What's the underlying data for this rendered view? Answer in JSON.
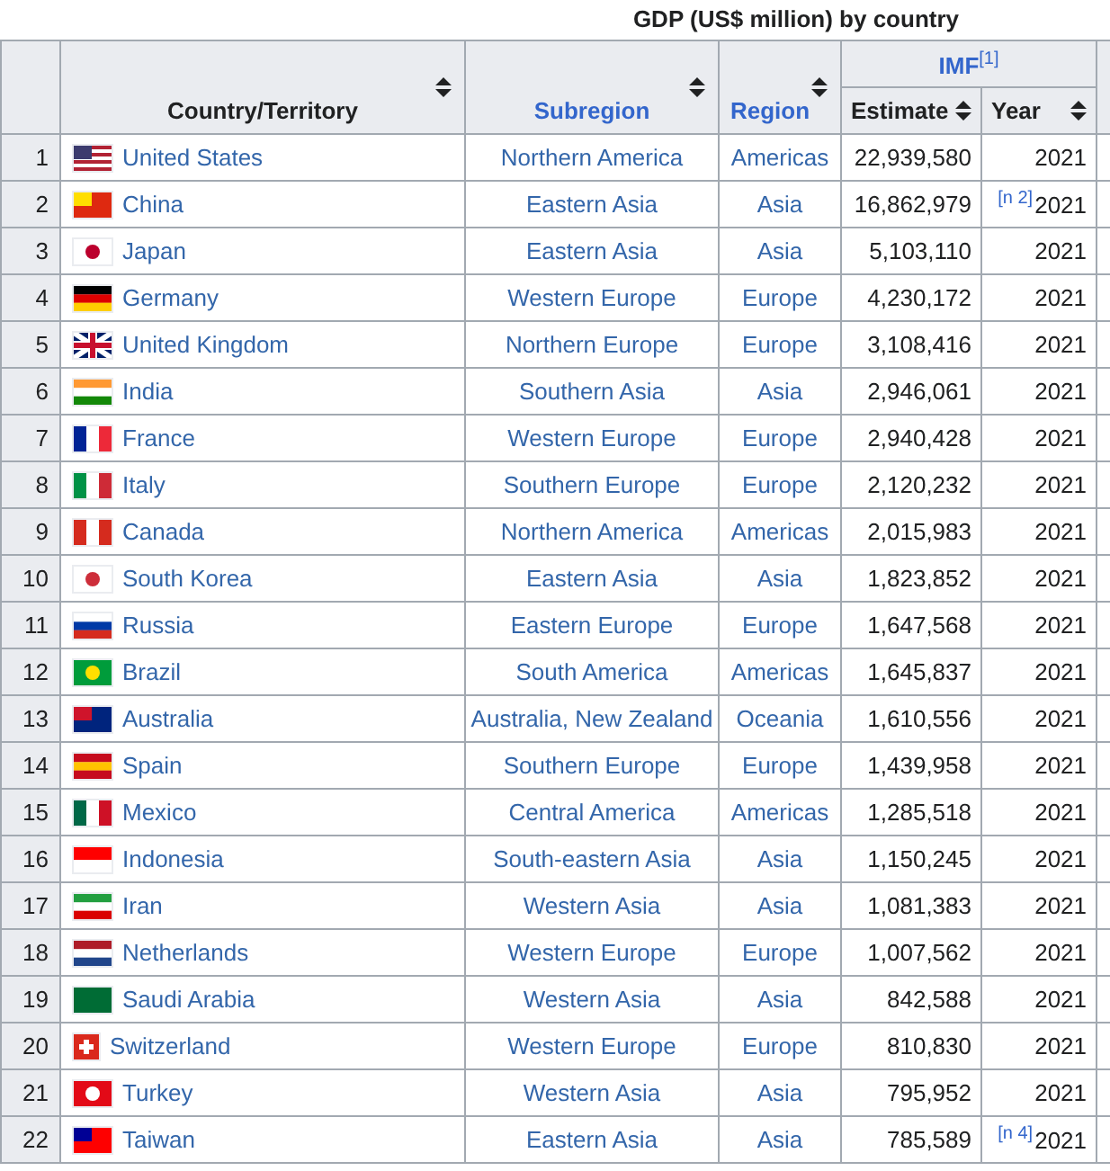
{
  "title": "GDP (US$ million) by country",
  "columns": {
    "country": "Country/Territory",
    "subregion": "Subregion",
    "region": "Region",
    "group": "IMF",
    "group_note": "[1]",
    "estimate": "Estimate",
    "year": "Year"
  },
  "rows": [
    {
      "rank": "1",
      "country": "United States",
      "subregion": "Northern America",
      "region": "Americas",
      "estimate": "22,939,580",
      "year": "2021"
    },
    {
      "rank": "2",
      "country": "China",
      "subregion": "Eastern Asia",
      "region": "Asia",
      "estimate": "16,862,979",
      "note": "[n 2]",
      "year": "2021"
    },
    {
      "rank": "3",
      "country": "Japan",
      "subregion": "Eastern Asia",
      "region": "Asia",
      "estimate": "5,103,110",
      "year": "2021"
    },
    {
      "rank": "4",
      "country": "Germany",
      "subregion": "Western Europe",
      "region": "Europe",
      "estimate": "4,230,172",
      "year": "2021"
    },
    {
      "rank": "5",
      "country": "United Kingdom",
      "subregion": "Northern Europe",
      "region": "Europe",
      "estimate": "3,108,416",
      "year": "2021"
    },
    {
      "rank": "6",
      "country": "India",
      "subregion": "Southern Asia",
      "region": "Asia",
      "estimate": "2,946,061",
      "year": "2021"
    },
    {
      "rank": "7",
      "country": "France",
      "subregion": "Western Europe",
      "region": "Europe",
      "estimate": "2,940,428",
      "year": "2021"
    },
    {
      "rank": "8",
      "country": "Italy",
      "subregion": "Southern Europe",
      "region": "Europe",
      "estimate": "2,120,232",
      "year": "2021"
    },
    {
      "rank": "9",
      "country": "Canada",
      "subregion": "Northern America",
      "region": "Americas",
      "estimate": "2,015,983",
      "year": "2021"
    },
    {
      "rank": "10",
      "country": "South Korea",
      "subregion": "Eastern Asia",
      "region": "Asia",
      "estimate": "1,823,852",
      "year": "2021"
    },
    {
      "rank": "11",
      "country": "Russia",
      "subregion": "Eastern Europe",
      "region": "Europe",
      "estimate": "1,647,568",
      "year": "2021"
    },
    {
      "rank": "12",
      "country": "Brazil",
      "subregion": "South America",
      "region": "Americas",
      "estimate": "1,645,837",
      "year": "2021"
    },
    {
      "rank": "13",
      "country": "Australia",
      "subregion": "Australia, New Zealand",
      "region": "Oceania",
      "estimate": "1,610,556",
      "year": "2021"
    },
    {
      "rank": "14",
      "country": "Spain",
      "subregion": "Southern Europe",
      "region": "Europe",
      "estimate": "1,439,958",
      "year": "2021"
    },
    {
      "rank": "15",
      "country": "Mexico",
      "subregion": "Central America",
      "region": "Americas",
      "estimate": "1,285,518",
      "year": "2021"
    },
    {
      "rank": "16",
      "country": "Indonesia",
      "subregion": "South-eastern Asia",
      "region": "Asia",
      "estimate": "1,150,245",
      "year": "2021"
    },
    {
      "rank": "17",
      "country": "Iran",
      "subregion": "Western Asia",
      "region": "Asia",
      "estimate": "1,081,383",
      "year": "2021"
    },
    {
      "rank": "18",
      "country": "Netherlands",
      "subregion": "Western Europe",
      "region": "Europe",
      "estimate": "1,007,562",
      "year": "2021"
    },
    {
      "rank": "19",
      "country": "Saudi Arabia",
      "subregion": "Western Asia",
      "region": "Asia",
      "estimate": "842,588",
      "year": "2021"
    },
    {
      "rank": "20",
      "country": "Switzerland",
      "subregion": "Western Europe",
      "region": "Europe",
      "estimate": "810,830",
      "year": "2021"
    },
    {
      "rank": "21",
      "country": "Turkey",
      "subregion": "Western Asia",
      "region": "Asia",
      "estimate": "795,952",
      "year": "2021"
    },
    {
      "rank": "22",
      "country": "Taiwan",
      "subregion": "Eastern Asia",
      "region": "Asia",
      "estimate": "785,589",
      "note": "[n 4]",
      "year": "2021"
    }
  ]
}
